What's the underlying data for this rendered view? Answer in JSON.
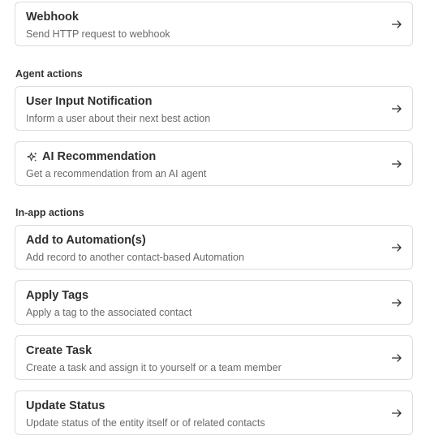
{
  "cards": {
    "webhook": {
      "title": "Webhook",
      "description": "Send HTTP request to webhook",
      "icon": "arrow-right-icon"
    },
    "user_input_notification": {
      "title": "User Input Notification",
      "description": "Inform a user about their next best action",
      "icon": "arrow-right-icon"
    },
    "ai_recommendation": {
      "title": "AI Recommendation",
      "description": "Get a recommendation from an AI agent",
      "icon": "arrow-right-icon",
      "leading_icon": "sparkle-icon"
    },
    "add_to_automation": {
      "title": "Add to Automation(s)",
      "description": "Add record to another contact-based Automation",
      "icon": "arrow-right-icon"
    },
    "apply_tags": {
      "title": "Apply Tags",
      "description": "Apply a tag to the associated contact",
      "icon": "arrow-right-icon"
    },
    "create_task": {
      "title": "Create Task",
      "description": "Create a task and assign it to yourself or a team member",
      "icon": "arrow-right-icon"
    },
    "update_status": {
      "title": "Update Status",
      "description": "Update status of the entity itself or of related contacts",
      "icon": "arrow-right-icon"
    }
  },
  "sections": {
    "agent_actions": "Agent actions",
    "in_app_actions": "In-app actions"
  },
  "colors": {
    "border": "#dcdcdc",
    "title": "#2f2f2f",
    "description": "#6a6a6a",
    "background": "#ffffff"
  }
}
